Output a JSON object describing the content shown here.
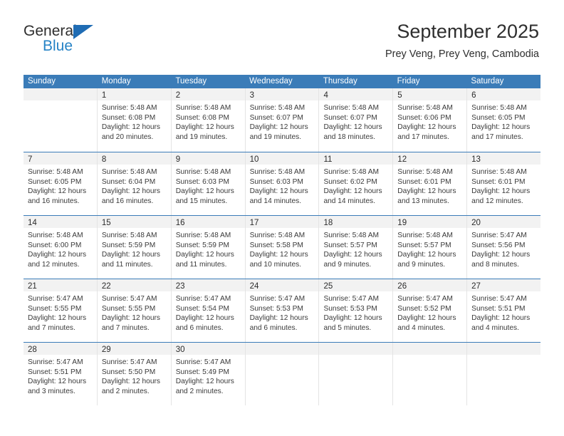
{
  "brand": {
    "name_top": "General",
    "name_bottom": "Blue",
    "triangle_icon": "triangle-icon",
    "accent_color": "#2683c6",
    "logo_blue": "#1f6cb4"
  },
  "header": {
    "title": "September 2025",
    "subtitle": "Prey Veng, Prey Veng, Cambodia"
  },
  "calendar": {
    "header_bg": "#3b7cb8",
    "day_band_bg": "#f2f2f2",
    "day_names": [
      "Sunday",
      "Monday",
      "Tuesday",
      "Wednesday",
      "Thursday",
      "Friday",
      "Saturday"
    ],
    "weeks": [
      [
        {
          "day": "",
          "sunrise": "",
          "sunset": "",
          "daylight_1": "",
          "daylight_2": "",
          "empty": true
        },
        {
          "day": "1",
          "sunrise": "Sunrise: 5:48 AM",
          "sunset": "Sunset: 6:08 PM",
          "daylight_1": "Daylight: 12 hours",
          "daylight_2": "and 20 minutes."
        },
        {
          "day": "2",
          "sunrise": "Sunrise: 5:48 AM",
          "sunset": "Sunset: 6:08 PM",
          "daylight_1": "Daylight: 12 hours",
          "daylight_2": "and 19 minutes."
        },
        {
          "day": "3",
          "sunrise": "Sunrise: 5:48 AM",
          "sunset": "Sunset: 6:07 PM",
          "daylight_1": "Daylight: 12 hours",
          "daylight_2": "and 19 minutes."
        },
        {
          "day": "4",
          "sunrise": "Sunrise: 5:48 AM",
          "sunset": "Sunset: 6:07 PM",
          "daylight_1": "Daylight: 12 hours",
          "daylight_2": "and 18 minutes."
        },
        {
          "day": "5",
          "sunrise": "Sunrise: 5:48 AM",
          "sunset": "Sunset: 6:06 PM",
          "daylight_1": "Daylight: 12 hours",
          "daylight_2": "and 17 minutes."
        },
        {
          "day": "6",
          "sunrise": "Sunrise: 5:48 AM",
          "sunset": "Sunset: 6:05 PM",
          "daylight_1": "Daylight: 12 hours",
          "daylight_2": "and 17 minutes."
        }
      ],
      [
        {
          "day": "7",
          "sunrise": "Sunrise: 5:48 AM",
          "sunset": "Sunset: 6:05 PM",
          "daylight_1": "Daylight: 12 hours",
          "daylight_2": "and 16 minutes."
        },
        {
          "day": "8",
          "sunrise": "Sunrise: 5:48 AM",
          "sunset": "Sunset: 6:04 PM",
          "daylight_1": "Daylight: 12 hours",
          "daylight_2": "and 16 minutes."
        },
        {
          "day": "9",
          "sunrise": "Sunrise: 5:48 AM",
          "sunset": "Sunset: 6:03 PM",
          "daylight_1": "Daylight: 12 hours",
          "daylight_2": "and 15 minutes."
        },
        {
          "day": "10",
          "sunrise": "Sunrise: 5:48 AM",
          "sunset": "Sunset: 6:03 PM",
          "daylight_1": "Daylight: 12 hours",
          "daylight_2": "and 14 minutes."
        },
        {
          "day": "11",
          "sunrise": "Sunrise: 5:48 AM",
          "sunset": "Sunset: 6:02 PM",
          "daylight_1": "Daylight: 12 hours",
          "daylight_2": "and 14 minutes."
        },
        {
          "day": "12",
          "sunrise": "Sunrise: 5:48 AM",
          "sunset": "Sunset: 6:01 PM",
          "daylight_1": "Daylight: 12 hours",
          "daylight_2": "and 13 minutes."
        },
        {
          "day": "13",
          "sunrise": "Sunrise: 5:48 AM",
          "sunset": "Sunset: 6:01 PM",
          "daylight_1": "Daylight: 12 hours",
          "daylight_2": "and 12 minutes."
        }
      ],
      [
        {
          "day": "14",
          "sunrise": "Sunrise: 5:48 AM",
          "sunset": "Sunset: 6:00 PM",
          "daylight_1": "Daylight: 12 hours",
          "daylight_2": "and 12 minutes."
        },
        {
          "day": "15",
          "sunrise": "Sunrise: 5:48 AM",
          "sunset": "Sunset: 5:59 PM",
          "daylight_1": "Daylight: 12 hours",
          "daylight_2": "and 11 minutes."
        },
        {
          "day": "16",
          "sunrise": "Sunrise: 5:48 AM",
          "sunset": "Sunset: 5:59 PM",
          "daylight_1": "Daylight: 12 hours",
          "daylight_2": "and 11 minutes."
        },
        {
          "day": "17",
          "sunrise": "Sunrise: 5:48 AM",
          "sunset": "Sunset: 5:58 PM",
          "daylight_1": "Daylight: 12 hours",
          "daylight_2": "and 10 minutes."
        },
        {
          "day": "18",
          "sunrise": "Sunrise: 5:48 AM",
          "sunset": "Sunset: 5:57 PM",
          "daylight_1": "Daylight: 12 hours",
          "daylight_2": "and 9 minutes."
        },
        {
          "day": "19",
          "sunrise": "Sunrise: 5:48 AM",
          "sunset": "Sunset: 5:57 PM",
          "daylight_1": "Daylight: 12 hours",
          "daylight_2": "and 9 minutes."
        },
        {
          "day": "20",
          "sunrise": "Sunrise: 5:47 AM",
          "sunset": "Sunset: 5:56 PM",
          "daylight_1": "Daylight: 12 hours",
          "daylight_2": "and 8 minutes."
        }
      ],
      [
        {
          "day": "21",
          "sunrise": "Sunrise: 5:47 AM",
          "sunset": "Sunset: 5:55 PM",
          "daylight_1": "Daylight: 12 hours",
          "daylight_2": "and 7 minutes."
        },
        {
          "day": "22",
          "sunrise": "Sunrise: 5:47 AM",
          "sunset": "Sunset: 5:55 PM",
          "daylight_1": "Daylight: 12 hours",
          "daylight_2": "and 7 minutes."
        },
        {
          "day": "23",
          "sunrise": "Sunrise: 5:47 AM",
          "sunset": "Sunset: 5:54 PM",
          "daylight_1": "Daylight: 12 hours",
          "daylight_2": "and 6 minutes."
        },
        {
          "day": "24",
          "sunrise": "Sunrise: 5:47 AM",
          "sunset": "Sunset: 5:53 PM",
          "daylight_1": "Daylight: 12 hours",
          "daylight_2": "and 6 minutes."
        },
        {
          "day": "25",
          "sunrise": "Sunrise: 5:47 AM",
          "sunset": "Sunset: 5:53 PM",
          "daylight_1": "Daylight: 12 hours",
          "daylight_2": "and 5 minutes."
        },
        {
          "day": "26",
          "sunrise": "Sunrise: 5:47 AM",
          "sunset": "Sunset: 5:52 PM",
          "daylight_1": "Daylight: 12 hours",
          "daylight_2": "and 4 minutes."
        },
        {
          "day": "27",
          "sunrise": "Sunrise: 5:47 AM",
          "sunset": "Sunset: 5:51 PM",
          "daylight_1": "Daylight: 12 hours",
          "daylight_2": "and 4 minutes."
        }
      ],
      [
        {
          "day": "28",
          "sunrise": "Sunrise: 5:47 AM",
          "sunset": "Sunset: 5:51 PM",
          "daylight_1": "Daylight: 12 hours",
          "daylight_2": "and 3 minutes."
        },
        {
          "day": "29",
          "sunrise": "Sunrise: 5:47 AM",
          "sunset": "Sunset: 5:50 PM",
          "daylight_1": "Daylight: 12 hours",
          "daylight_2": "and 2 minutes."
        },
        {
          "day": "30",
          "sunrise": "Sunrise: 5:47 AM",
          "sunset": "Sunset: 5:49 PM",
          "daylight_1": "Daylight: 12 hours",
          "daylight_2": "and 2 minutes."
        },
        {
          "day": "",
          "sunrise": "",
          "sunset": "",
          "daylight_1": "",
          "daylight_2": "",
          "empty": true
        },
        {
          "day": "",
          "sunrise": "",
          "sunset": "",
          "daylight_1": "",
          "daylight_2": "",
          "empty": true
        },
        {
          "day": "",
          "sunrise": "",
          "sunset": "",
          "daylight_1": "",
          "daylight_2": "",
          "empty": true
        },
        {
          "day": "",
          "sunrise": "",
          "sunset": "",
          "daylight_1": "",
          "daylight_2": "",
          "empty": true
        }
      ]
    ]
  }
}
